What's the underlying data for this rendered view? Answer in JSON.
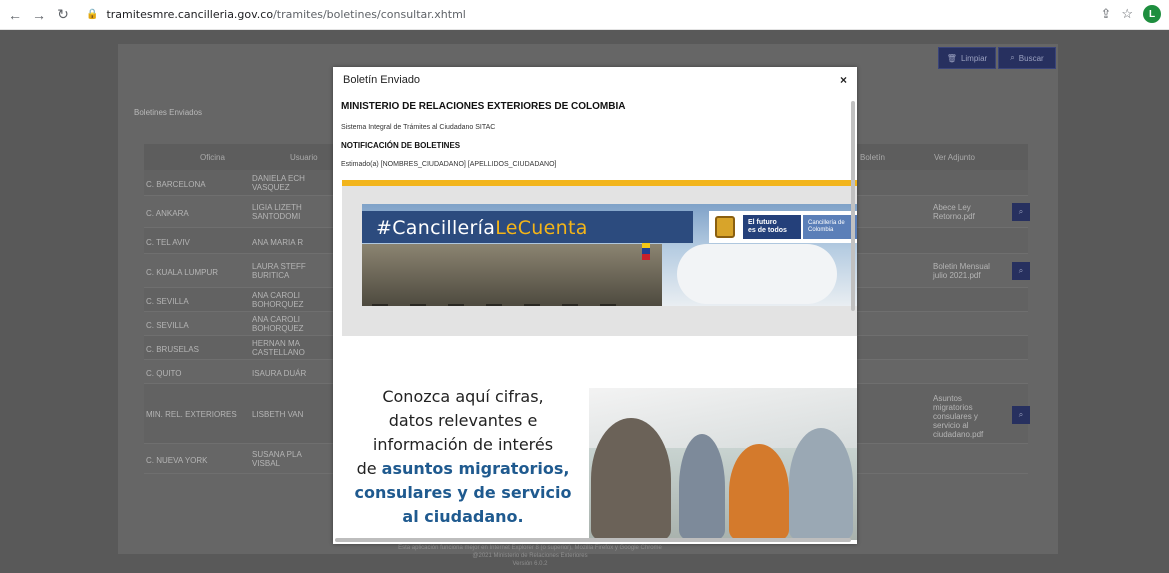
{
  "browser": {
    "url_host": "tramitesmre.cancilleria.gov.co",
    "url_path": "/tramites/boletines/consultar.xhtml",
    "profile_initial": "L"
  },
  "page": {
    "section_title": "Boletines Enviados",
    "clear_button": "Limpiar",
    "search_button": "Buscar",
    "columns": [
      "Oficina",
      "Usuario",
      "Boletín",
      "Ver Adjunto"
    ],
    "rows": [
      {
        "office": "C. BARCELONA",
        "user": "DANIELA ECH VASQUEZ",
        "attachment": ""
      },
      {
        "office": "C. ANKARA",
        "user": "LIGIA LIZETH SANTODOMI",
        "attachment": "Abece Ley Retorno.pdf"
      },
      {
        "office": "C. TEL AVIV",
        "user": "ANA MARIA R",
        "attachment": ""
      },
      {
        "office": "C. KUALA LUMPUR",
        "user": "LAURA STEFF BURITICA",
        "attachment": "Boletin Mensual julio 2021.pdf"
      },
      {
        "office": "C. SEVILLA",
        "user": "ANA CAROLI BOHORQUEZ",
        "attachment": ""
      },
      {
        "office": "C. SEVILLA",
        "user": "ANA CAROLI BOHORQUEZ",
        "attachment": ""
      },
      {
        "office": "C. BRUSELAS",
        "user": "HERNAN MA CASTELLANO",
        "attachment": ""
      },
      {
        "office": "C. QUITO",
        "user": "ISAURA DUÁR",
        "attachment": ""
      },
      {
        "office": "MIN. REL. EXTERIORES",
        "user": "LISBETH VAN",
        "attachment": "Asuntos migratorios consulares y servicio al ciudadano.pdf"
      },
      {
        "office": "C. NUEVA YORK",
        "user": "SUSANA PLA VISBAL",
        "attachment": ""
      }
    ],
    "footer_line1": "Esta aplicación funciona mejor en Internet Explorer 8 (o superior), Mozilla Firefox y Google Chrome",
    "footer_line2": "@2021 Ministerio de Relaciones Exteriores",
    "footer_line3": "Versión 6.0.2"
  },
  "modal": {
    "title": "Boletín Enviado",
    "close": "×",
    "ministry": "MINISTERIO DE RELACIONES EXTERIORES DE COLOMBIA",
    "system": "Sistema Integral de Trámites al Ciudadano SITAC",
    "notification": "NOTIFICACIÓN DE BOLETINES",
    "greeting": "Estimado(a) [NOMBRES_CIUDADANO] [APELLIDOS_CIUDADANO]",
    "banner_hash": "#Cancillería",
    "banner_highlight": "LeCuenta",
    "logo_line1": "El futuro",
    "logo_line2": "es de todos",
    "logo_side": "Cancillería de Colombia",
    "promo_line1": "Conozca aquí cifras,",
    "promo_line2": "datos relevantes e",
    "promo_line3": "información de interés",
    "promo_line4": "de",
    "promo_accent1": "asuntos migratorios,",
    "promo_accent2": "consulares y de servicio",
    "promo_accent3": "al ciudadano."
  }
}
